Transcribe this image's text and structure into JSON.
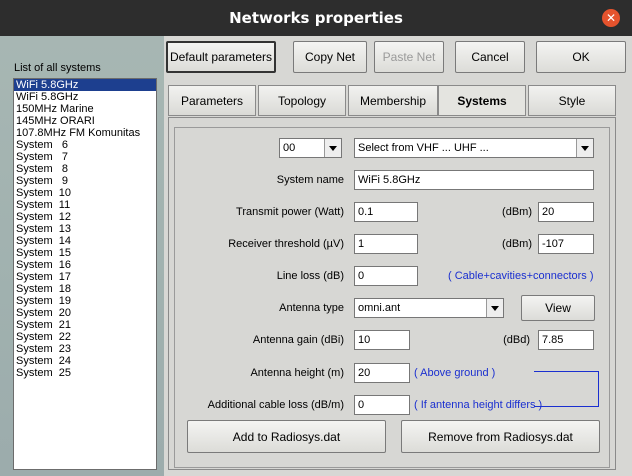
{
  "window": {
    "title": "Networks properties",
    "close_glyph": "✕"
  },
  "toolbar": {
    "default_params": "Default parameters",
    "copy_net": "Copy Net",
    "paste_net": "Paste Net",
    "cancel": "Cancel",
    "ok": "OK"
  },
  "list": {
    "label": "List of all systems",
    "items": [
      "WiFi 5.8GHz",
      "WiFi 5.8GHz",
      "150MHz Marine",
      "145MHz ORARI",
      "107.8MHz FM Komunitas",
      "System   6",
      "System   7",
      "System   8",
      "System   9",
      "System  10",
      "System  11",
      "System  12",
      "System  13",
      "System  14",
      "System  15",
      "System  16",
      "System  17",
      "System  18",
      "System  19",
      "System  20",
      "System  21",
      "System  22",
      "System  23",
      "System  24",
      "System  25"
    ],
    "selected_index": 0
  },
  "tabs": [
    "Parameters",
    "Topology",
    "Membership",
    "Systems",
    "Style"
  ],
  "active_tab": "Systems",
  "systems": {
    "index_value": "00",
    "band_select": "Select from VHF ... UHF ...",
    "system_name_label": "System name",
    "system_name": "WiFi 5.8GHz",
    "tx_power_label": "Transmit power (Watt)",
    "tx_power": "0.1",
    "tx_dbm_label": "(dBm)",
    "tx_dbm": "20",
    "rx_threshold_label": "Receiver threshold (µV)",
    "rx_threshold": "1",
    "rx_dbm_label": "(dBm)",
    "rx_dbm": "-107",
    "line_loss_label": "Line loss (dB)",
    "line_loss": "0",
    "line_loss_note": "( Cable+cavities+connectors )",
    "antenna_type_label": "Antenna type",
    "antenna_type": "omni.ant",
    "view_button": "View",
    "antenna_gain_label": "Antenna gain (dBi)",
    "antenna_gain": "10",
    "dbd_label": "(dBd)",
    "antenna_gain_dbd": "7.85",
    "antenna_height_label": "Antenna height (m)",
    "antenna_height": "20",
    "antenna_height_note": "( Above ground )",
    "cable_loss_label": "Additional cable loss (dB/m)",
    "cable_loss": "0",
    "cable_loss_note": "( If antenna height differs )",
    "add_button": "Add to Radiosys.dat",
    "remove_button": "Remove from Radiosys.dat"
  },
  "colors": {
    "accent_blue": "#1a2fd0",
    "selection": "#1d3f8f",
    "close": "#e5532d"
  }
}
